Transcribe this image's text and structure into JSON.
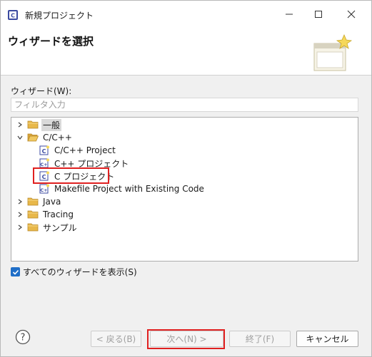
{
  "window": {
    "title": "新規プロジェクト",
    "minimize_glyph": "—",
    "maximize_glyph": "☐",
    "close_glyph": "✕"
  },
  "header": {
    "title": "ウィザードを選択"
  },
  "wizard_label": "ウィザード(W):",
  "filter": {
    "placeholder": "フィルタ入力",
    "value": ""
  },
  "tree": {
    "items": [
      {
        "label": "一般",
        "expanded": false,
        "selected": true,
        "icon": "folder-icon"
      },
      {
        "label": "C/C++",
        "expanded": true,
        "icon": "folder-icon"
      },
      {
        "label": "C/C++ Project",
        "icon": "c-project-icon"
      },
      {
        "label": "C++ プロジェクト",
        "icon": "cpp-project-icon"
      },
      {
        "label": "C プロジェクト",
        "icon": "c-project-icon"
      },
      {
        "label": "Makefile Project with Existing Code",
        "icon": "makefile-project-icon"
      },
      {
        "label": "Java",
        "expanded": false,
        "icon": "folder-icon"
      },
      {
        "label": "Tracing",
        "expanded": false,
        "icon": "folder-icon"
      },
      {
        "label": "サンプル",
        "expanded": false,
        "icon": "folder-icon"
      }
    ]
  },
  "show_all": {
    "label": "すべてのウィザードを表示(S)",
    "checked": true
  },
  "buttons": {
    "back": "< 戻る(B)",
    "next": "次へ(N) >",
    "finish": "終了(F)",
    "cancel": "キャンセル"
  },
  "colors": {
    "accent": "#1f6ec7",
    "highlight_box": "#e02020",
    "folder": "#e8b84a"
  }
}
